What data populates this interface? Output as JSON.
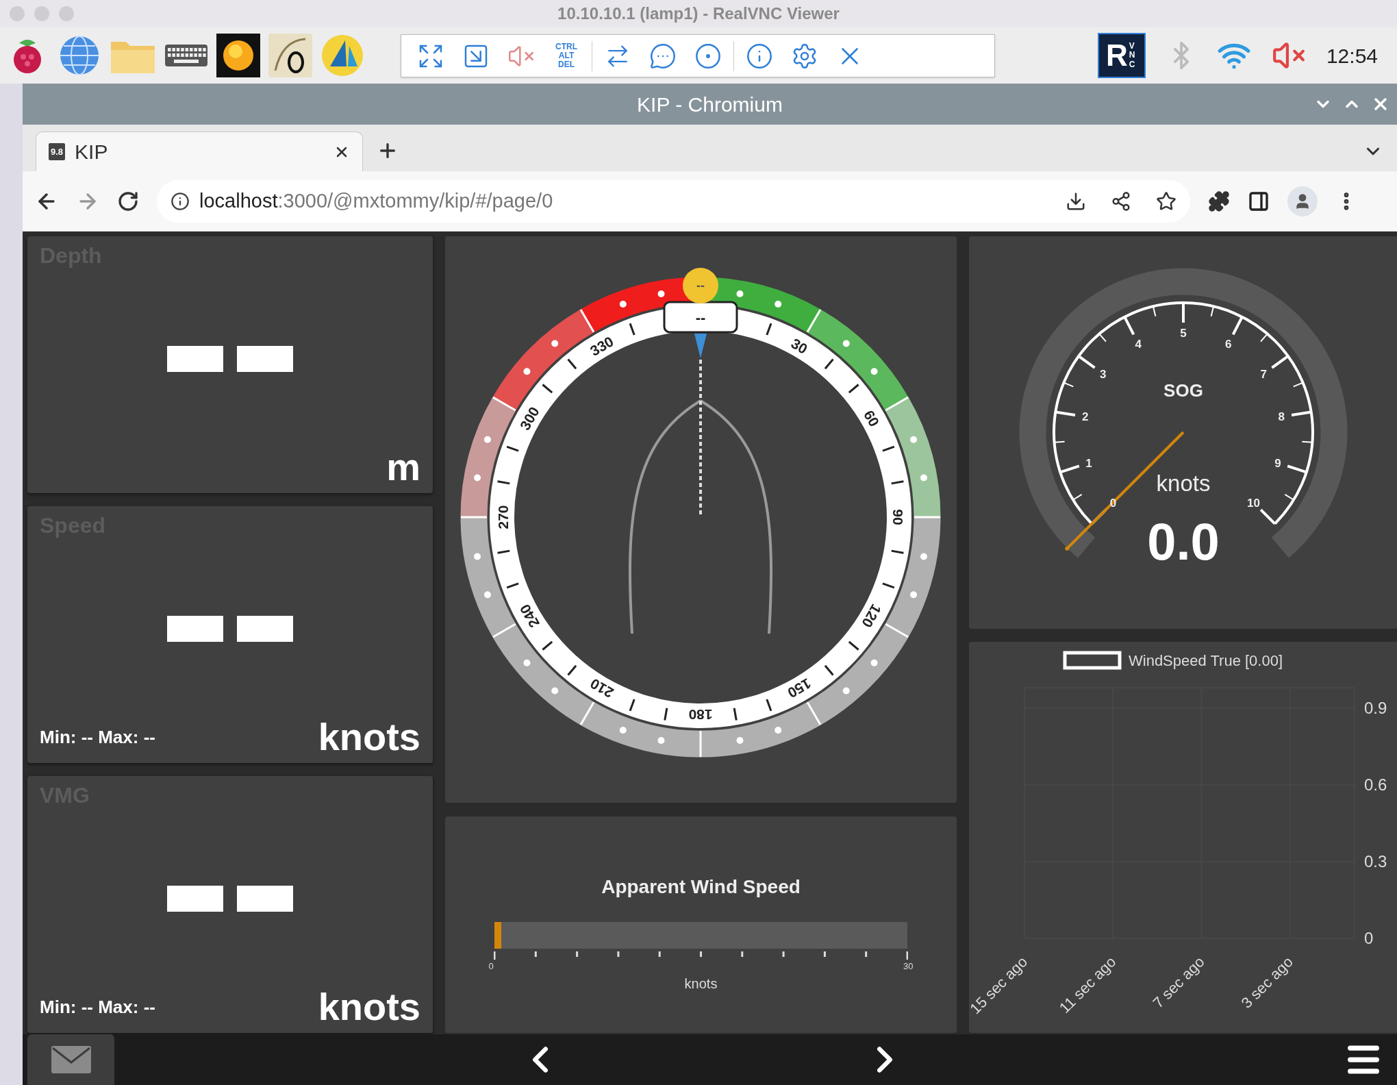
{
  "vnc_window": {
    "title": "10.10.10.1 (lamp1) - RealVNC Viewer"
  },
  "vnc_toolbar": {
    "ctrl_alt_del": "CTRL ALT DEL"
  },
  "vnc_logo": {
    "letter": "R",
    "text": "VNC"
  },
  "taskbar": {
    "clock": "12:54"
  },
  "browser": {
    "title": "KIP - Chromium",
    "tabs": [
      {
        "favicon": "9.8",
        "label": "KIP",
        "selected": true
      }
    ],
    "address": {
      "host": "localhost",
      "path": ":3000/@mxtommy/kip/#/page/0"
    }
  },
  "widgets": {
    "left": [
      {
        "title": "Depth",
        "unit": "m"
      },
      {
        "title": "Speed",
        "minmax": "Min: -- Max: --",
        "unit": "knots"
      },
      {
        "title": "VMG",
        "minmax": "Min: -- Max: --",
        "unit": "knots"
      }
    ],
    "compass": {
      "top_value": "--",
      "heading_value": "--",
      "scale_labels": [
        "30",
        "60",
        "90",
        "120",
        "150",
        "180",
        "210",
        "240",
        "270",
        "300",
        "330"
      ]
    },
    "aws": {
      "title": "Apparent Wind Speed",
      "min": "0",
      "max": "30",
      "unit": "knots",
      "level": 0
    },
    "sog": {
      "title": "SOG",
      "unit": "knots",
      "value": "0.0",
      "tick_labels": [
        "0",
        "1",
        "2",
        "3",
        "4",
        "5",
        "6",
        "7",
        "8",
        "9",
        "10"
      ],
      "level": 0
    },
    "chart": {
      "chart_data": {
        "type": "line",
        "categories": [
          "15 sec ago",
          "11 sec ago",
          "7 sec ago",
          "3 sec ago"
        ],
        "series": [
          {
            "name": "WindSpeed True [0.00]",
            "color": "#ffffff",
            "values": [
              null,
              null,
              null,
              null
            ]
          }
        ],
        "grid": true,
        "ylim": [
          0,
          0.98
        ],
        "yticks": [
          0,
          0.3,
          0.6,
          0.9
        ]
      }
    }
  }
}
